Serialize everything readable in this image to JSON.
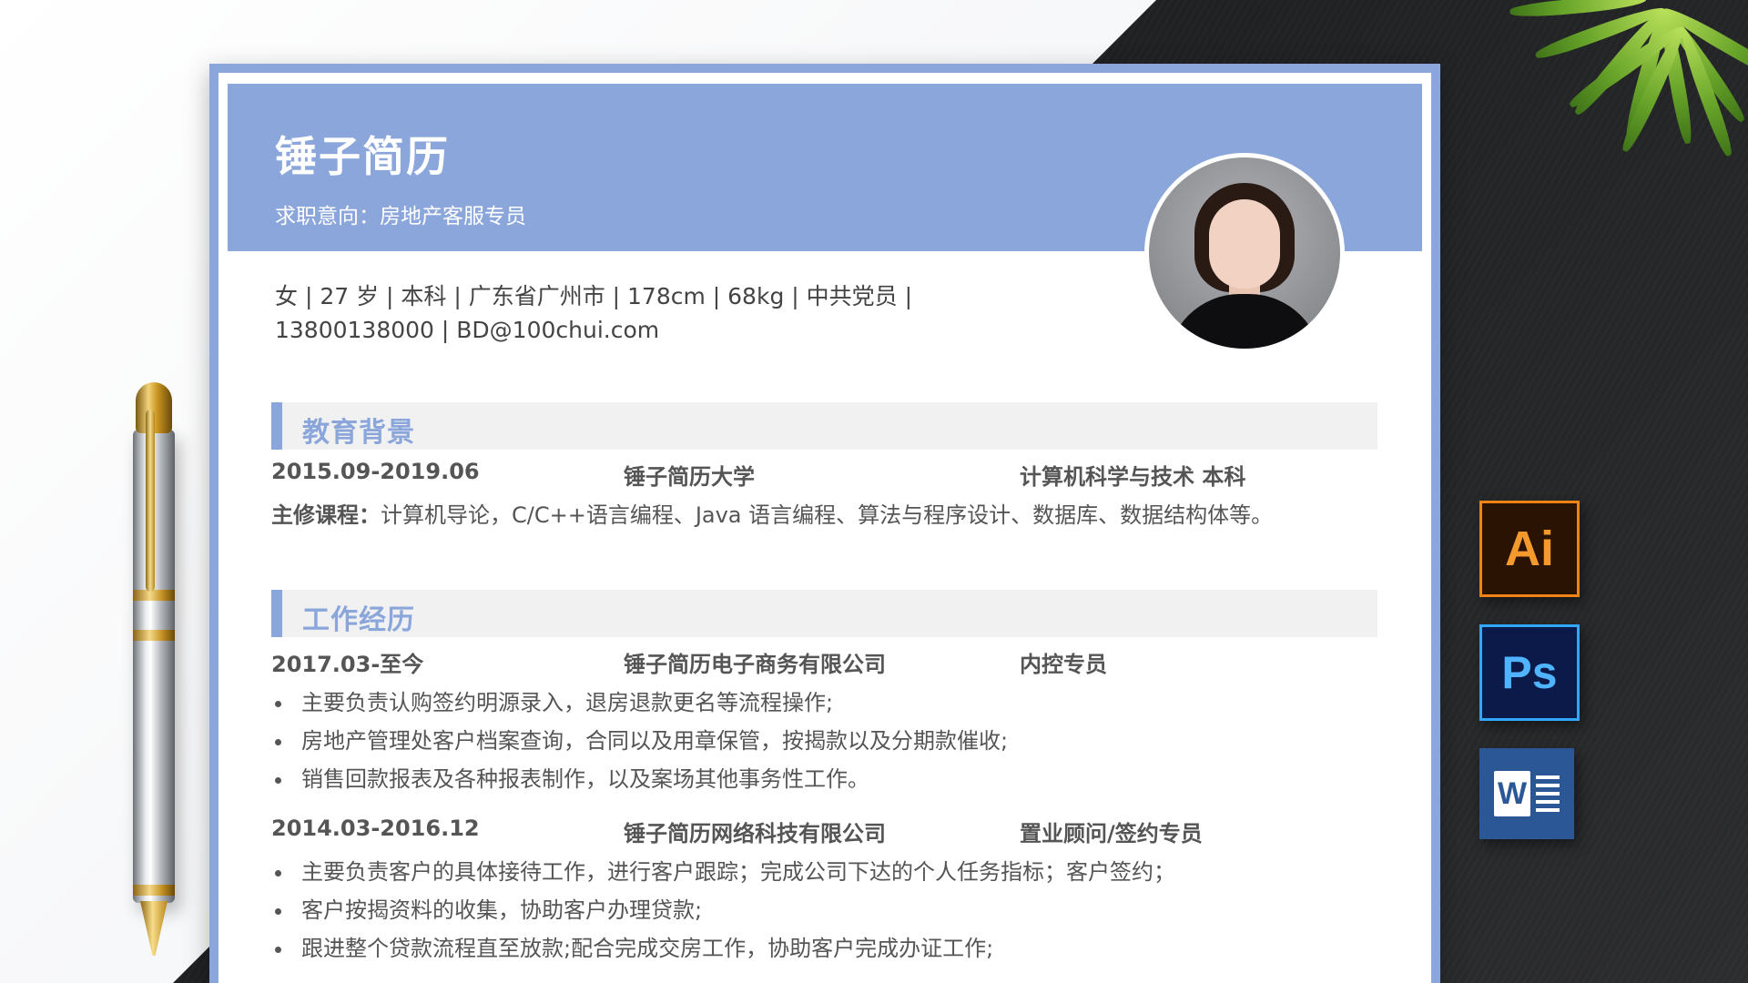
{
  "resume": {
    "name": "锤子简历",
    "intent": "求职意向：房地产客服专员",
    "info_line1": "女 | 27 岁 | 本科 | 广东省广州市 | 178cm | 68kg | 中共党员 |",
    "info_line2": "13800138000 | BD@100chui.com"
  },
  "education": {
    "title": "教育背景",
    "date": "2015.09-2019.06",
    "school": "锤子简历大学",
    "major": "计算机科学与技术  本科",
    "courses_label": "主修课程：",
    "courses": "计算机导论，C/C++语言编程、Java 语言编程、算法与程序设计、数据库、数据结构体等。"
  },
  "work": {
    "title": "工作经历",
    "jobs": [
      {
        "date": "2017.03-至今",
        "company": "锤子简历电子商务有限公司",
        "position": "内控专员",
        "duties": [
          "主要负责认购签约明源录入，退房退款更名等流程操作;",
          "房地产管理处客户档案查询，合同以及用章保管，按揭款以及分期款催收;",
          "销售回款报表及各种报表制作，以及案场其他事务性工作。"
        ]
      },
      {
        "date": "2014.03-2016.12",
        "company": "锤子简历网络科技有限公司",
        "position": "置业顾问/签约专员",
        "duties": [
          "主要负责客户的具体接待工作，进行客户跟踪；完成公司下达的个人任务指标；客户签约；",
          "客户按揭资料的收集，协助客户办理贷款;",
          "跟进整个贷款流程直至放款;配合完成交房工作，协助客户完成办证工作;"
        ]
      }
    ]
  },
  "icons": {
    "ai": "Ai",
    "ps": "Ps",
    "word": "W"
  },
  "colors": {
    "accent": "#8aa6db",
    "text": "#555555"
  }
}
